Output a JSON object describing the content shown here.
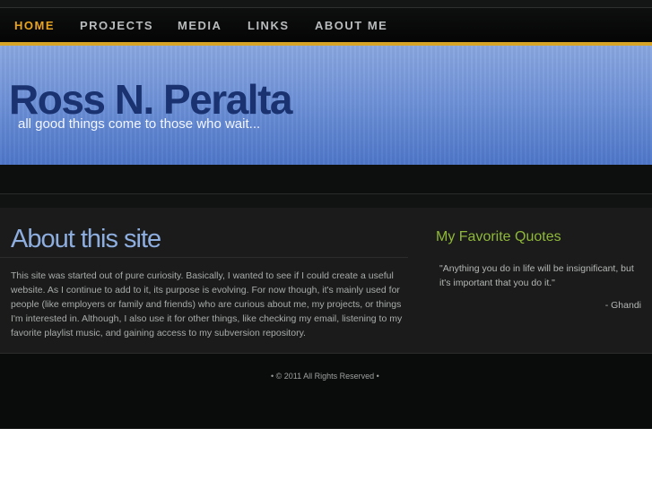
{
  "nav": {
    "items": [
      {
        "label": "HOME",
        "active": true
      },
      {
        "label": "PROJECTS",
        "active": false
      },
      {
        "label": "MEDIA",
        "active": false
      },
      {
        "label": "LINKS",
        "active": false
      },
      {
        "label": "ABOUT ME",
        "active": false
      }
    ]
  },
  "banner": {
    "title": "Ross N. Peralta",
    "tagline": "all good things come to those who wait..."
  },
  "about": {
    "heading": "About this site",
    "body": "This site was started out of pure curiosity. Basically, I wanted to see if I could create a useful website. As I continue to add to it, its purpose is evolving. For now though, it's mainly used for people (like employers or family and friends) who are curious about me, my projects, or things I'm interested in. Although, I also use it for other things, like checking my email, listening to my favorite playlist music, and gaining access to my subversion repository."
  },
  "quotes": {
    "heading": "My Favorite Quotes",
    "text": "\"Anything you do in life will be insignificant, but it's important that you do it.\"",
    "author": "- Ghandi"
  },
  "footer": {
    "text": "• ©  2011 All Rights Reserved  •"
  },
  "colors": {
    "nav_active": "#e8a420",
    "accent_gold": "#d8a428",
    "banner_blue": "#6f92d8",
    "title_navy": "#1a3370",
    "heading_blue": "#8eaee0",
    "quotes_green": "#8fb838"
  }
}
